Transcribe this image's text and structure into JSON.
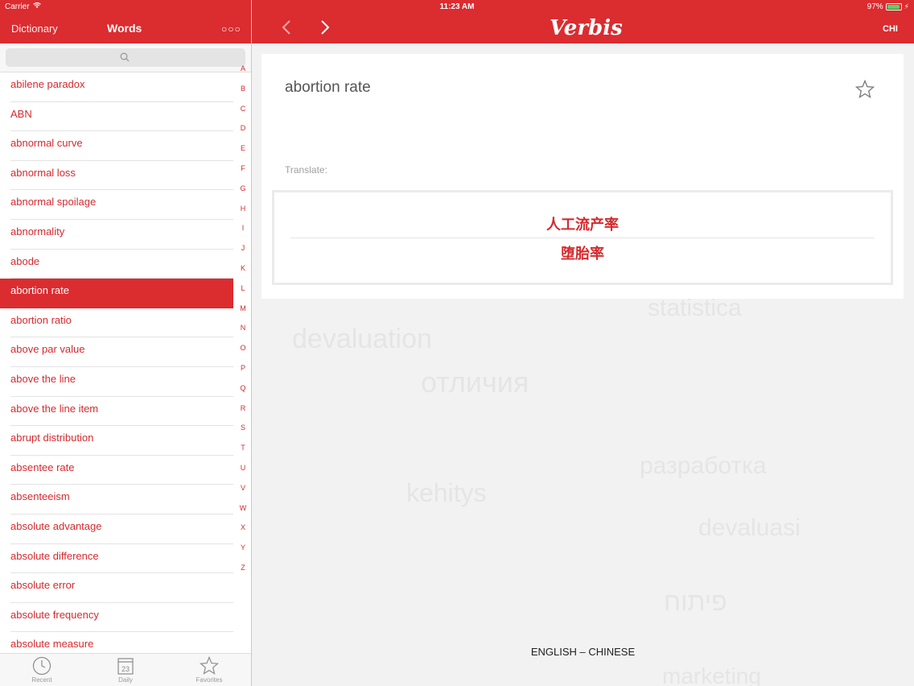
{
  "status": {
    "carrier": "Carrier",
    "time": "11:23 AM",
    "battery": "97%"
  },
  "left_header": {
    "dictionary_tab": "Dictionary",
    "words_tab": "Words"
  },
  "right_header": {
    "logo": "Verbis",
    "lang_code": "CHI"
  },
  "words": [
    "abilene paradox",
    "ABN",
    "abnormal curve",
    "abnormal loss",
    "abnormal spoilage",
    "abnormality",
    "abode",
    "abortion rate",
    "abortion ratio",
    "above par value",
    "above the line",
    "above the line item",
    "abrupt distribution",
    "absentee rate",
    "absenteeism",
    "absolute advantage",
    "absolute difference",
    "absolute error",
    "absolute frequency",
    "absolute measure"
  ],
  "selected_word_index": 7,
  "index_letters": [
    "A",
    "B",
    "C",
    "D",
    "E",
    "F",
    "G",
    "H",
    "I",
    "J",
    "K",
    "L",
    "M",
    "N",
    "O",
    "P",
    "Q",
    "R",
    "S",
    "T",
    "U",
    "V",
    "W",
    "X",
    "Y",
    "Z"
  ],
  "tabs": [
    {
      "label": "Recent",
      "icon": "clock-icon"
    },
    {
      "label": "Daily",
      "icon": "calendar-icon",
      "day": "23"
    },
    {
      "label": "Favorites",
      "icon": "star-icon"
    }
  ],
  "entry": {
    "term": "abortion rate",
    "translate_label": "Translate:",
    "translations": [
      "人工流产率",
      "堕胎率"
    ]
  },
  "background_words": [
    "statistica",
    "devaluation",
    "отличия",
    "разработка",
    "kehitys",
    "devaluasi",
    "פיתוח",
    "marketing"
  ],
  "language_pair": "ENGLISH – CHINESE"
}
